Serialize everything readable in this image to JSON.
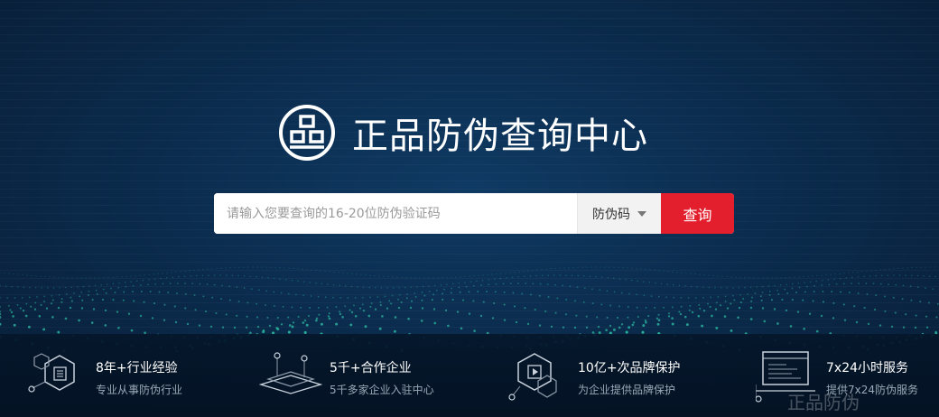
{
  "header": {
    "title": "正品防伪查询中心",
    "logo_icon": "product-seal-icon"
  },
  "search": {
    "placeholder": "请输入您要查询的16-20位防伪验证码",
    "type_selected": "防伪码",
    "submit_label": "查询"
  },
  "features": [
    {
      "title": "8年+行业经验",
      "subtitle": "专业从事防伪行业",
      "icon": "hexagon-document-icon"
    },
    {
      "title": "5千+合作企业",
      "subtitle": "5千多家企业入驻中心",
      "icon": "layered-platform-icon"
    },
    {
      "title": "10亿+次品牌保护",
      "subtitle": "为企业提供品牌保护",
      "icon": "hexagon-play-icon"
    },
    {
      "title": "7x24小时服务",
      "subtitle": "提供7x24防伪服务",
      "icon": "monitor-service-icon"
    }
  ],
  "watermark": "正品防伪",
  "colors": {
    "background": "#0b2c4e",
    "accent_red": "#e31f2d",
    "dot_teal": "#2ec7a8"
  }
}
